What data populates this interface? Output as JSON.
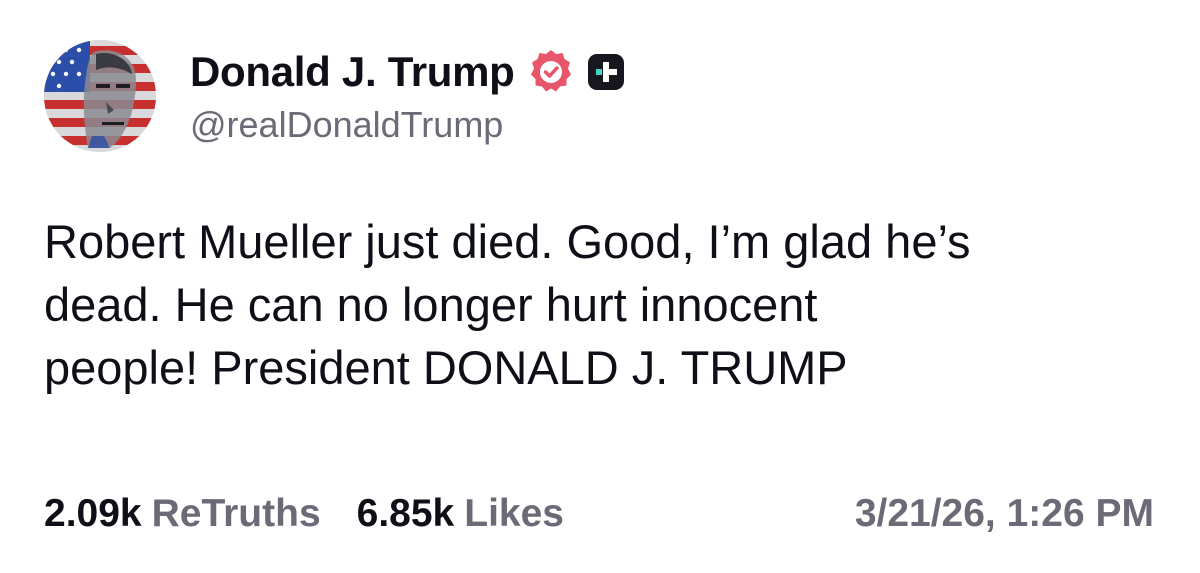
{
  "post": {
    "author": {
      "display_name": "Donald J. Trump",
      "handle": "@realDonaldTrump",
      "verified_icon": "verified-badge-icon",
      "plus_icon": "plus-badge-icon",
      "avatar": "avatar-image"
    },
    "text_lines": [
      "Robert Mueller just died. Good, I’m glad he’s",
      "dead. He can no longer hurt innocent",
      "people! President DONALD J. TRUMP"
    ],
    "stats": {
      "retruths_count": "2.09k",
      "retruths_label": "ReTruths",
      "likes_count": "6.85k",
      "likes_label": "Likes"
    },
    "timestamp": "3/21/26, 1:26 PM"
  },
  "colors": {
    "text_primary": "#0f0f17",
    "text_secondary": "#6b6b78",
    "verified_badge": "#e8566c",
    "plus_badge_bg": "#17171f",
    "plus_badge_accent": "#3fd6c4"
  }
}
